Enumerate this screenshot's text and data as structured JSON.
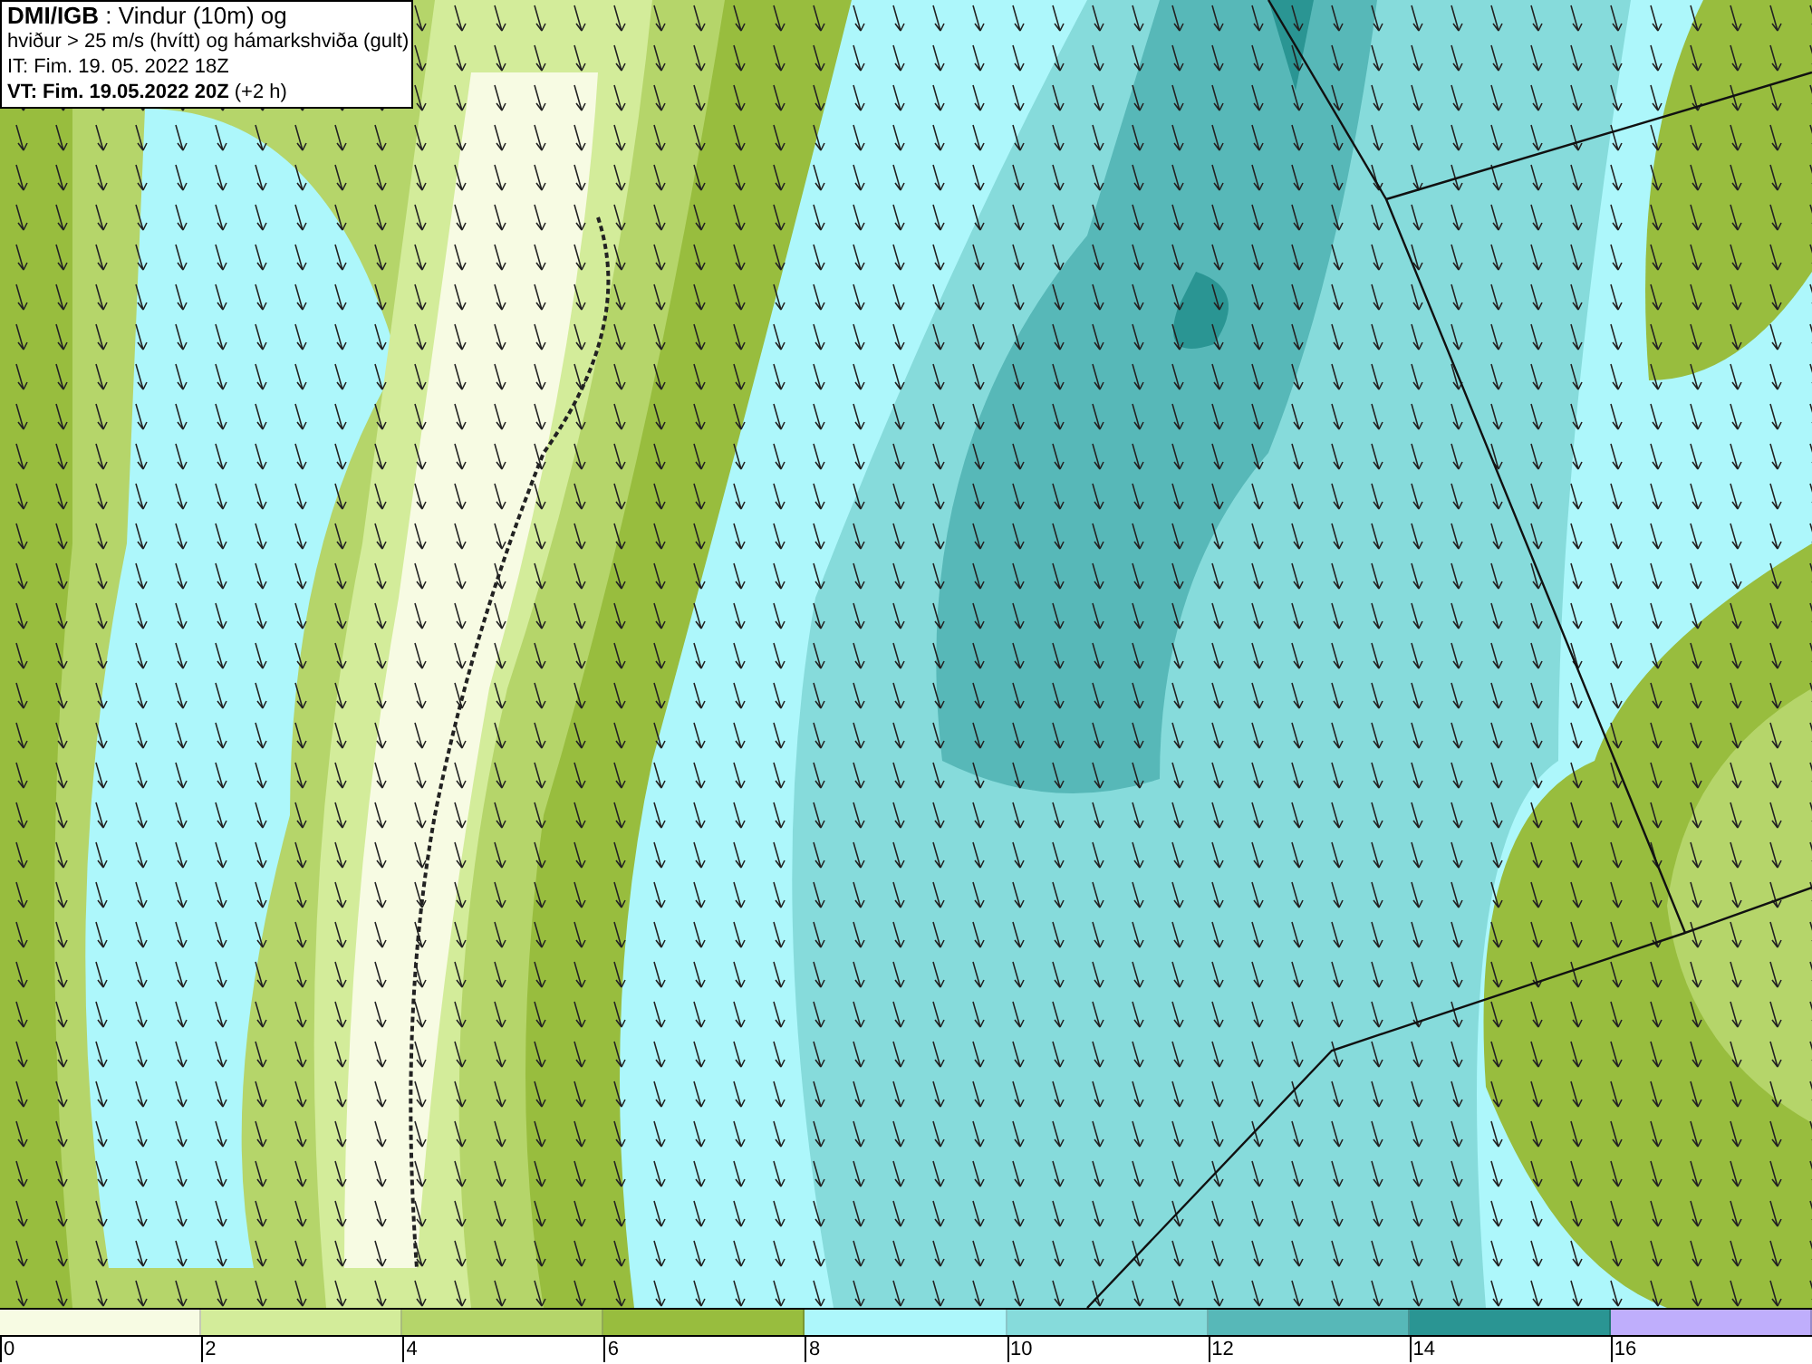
{
  "info_box": {
    "lines": [
      "**DMI/IGB** : Vindur (10m) og",
      "hviður > 25 m/s (hvítt) og hámarkshviða (gult)",
      "IT: Fim. 19. 05. 2022 18Z",
      "**VT: Fim. 19.05.2022 20Z** (+2 h)"
    ]
  },
  "legend": {
    "segments": [
      {
        "color": "#f7fbe3"
      },
      {
        "color": "#d3ec9a"
      },
      {
        "color": "#b5d56a"
      },
      {
        "color": "#98bd3e"
      },
      {
        "color": "#adf7fb"
      },
      {
        "color": "#86dbdb"
      },
      {
        "color": "#57b8b8"
      },
      {
        "color": "#2a9593"
      },
      {
        "color": "#bfaefc"
      }
    ],
    "ticks": [
      "0",
      "2",
      "4",
      "6",
      "8",
      "10",
      "12",
      "14",
      "16"
    ]
  }
}
